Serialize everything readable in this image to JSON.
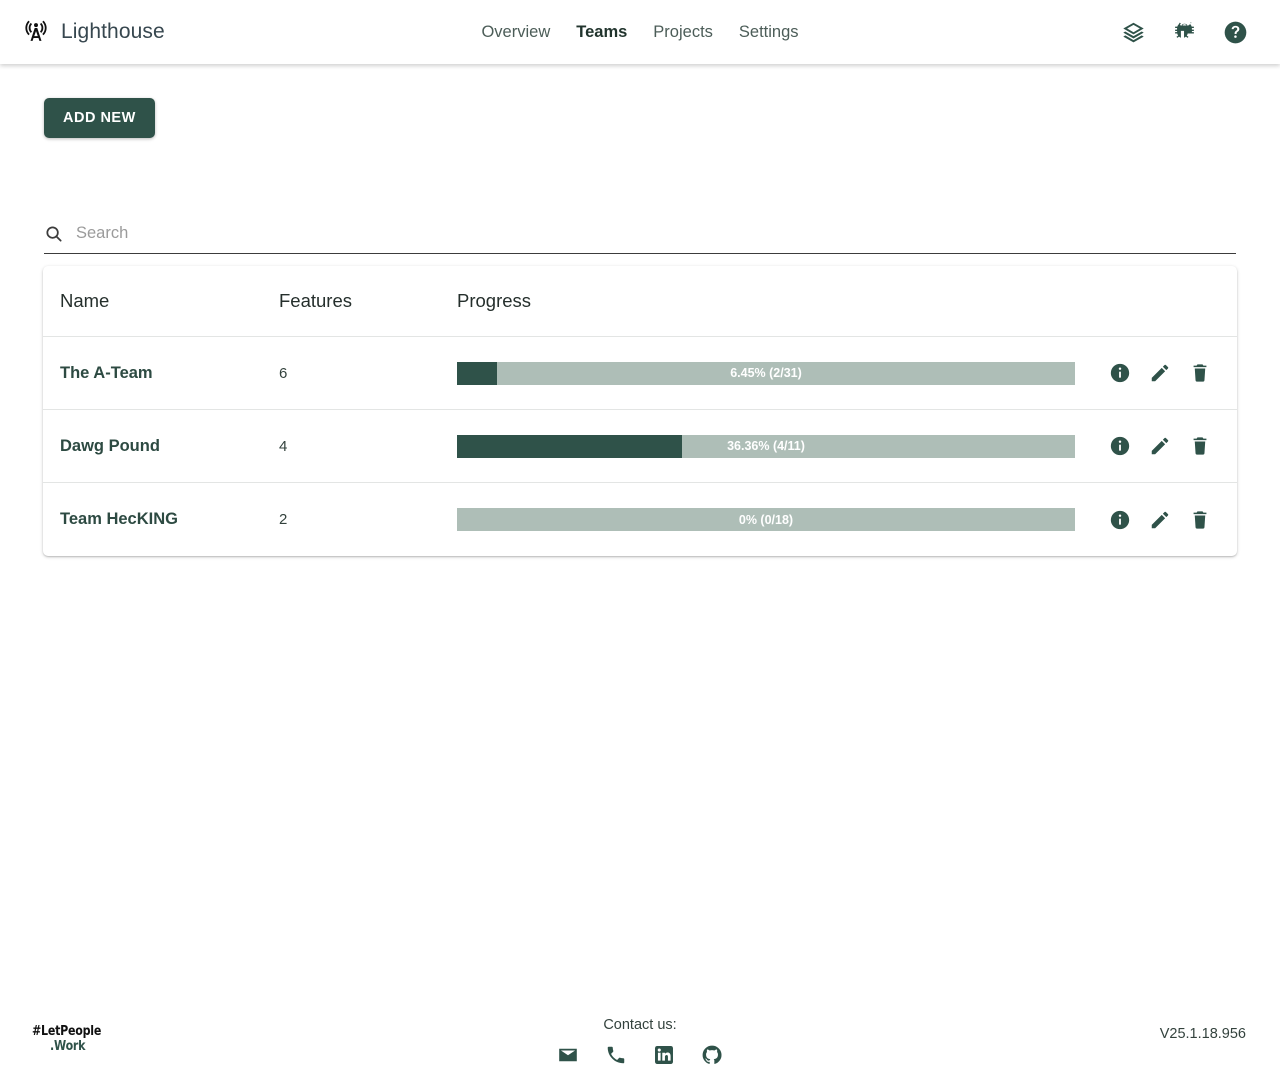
{
  "header": {
    "brand": "Lighthouse",
    "brand_icon": "broadcast-tower-icon",
    "nav": [
      {
        "label": "Overview",
        "active": false
      },
      {
        "label": "Teams",
        "active": true
      },
      {
        "label": "Projects",
        "active": false
      },
      {
        "label": "Settings",
        "active": false
      }
    ],
    "icons": [
      {
        "name": "layers-icon"
      },
      {
        "name": "bug-icon"
      },
      {
        "name": "help-circle-icon"
      }
    ]
  },
  "toolbar": {
    "add_new_label": "ADD NEW"
  },
  "search": {
    "placeholder": "Search",
    "value": "",
    "icon": "search-icon"
  },
  "table": {
    "columns": [
      "Name",
      "Features",
      "Progress"
    ],
    "row_actions": [
      {
        "name": "info-icon",
        "title": "Details"
      },
      {
        "name": "pencil-icon",
        "title": "Edit"
      },
      {
        "name": "trash-icon",
        "title": "Delete"
      }
    ],
    "rows": [
      {
        "name": "The A-Team",
        "features": "6",
        "progress_label": "6.45% (2/31)",
        "progress_percent": 6.45
      },
      {
        "name": "Dawg Pound",
        "features": "4",
        "progress_label": "36.36% (4/11)",
        "progress_percent": 36.36
      },
      {
        "name": "Team HecKING",
        "features": "2",
        "progress_label": "0% (0/18)",
        "progress_percent": 0
      }
    ]
  },
  "footer": {
    "logo_line1": "#LetPeople",
    "logo_line2": ".Work",
    "contact_title": "Contact us:",
    "social": [
      {
        "name": "email-icon"
      },
      {
        "name": "phone-icon"
      },
      {
        "name": "linkedin-icon"
      },
      {
        "name": "github-icon"
      }
    ],
    "version": "V25.1.18.956"
  },
  "colors": {
    "accent_dark_green": "#2F5249",
    "progress_track": "#AEBEB7",
    "brand_text": "#37474F"
  }
}
